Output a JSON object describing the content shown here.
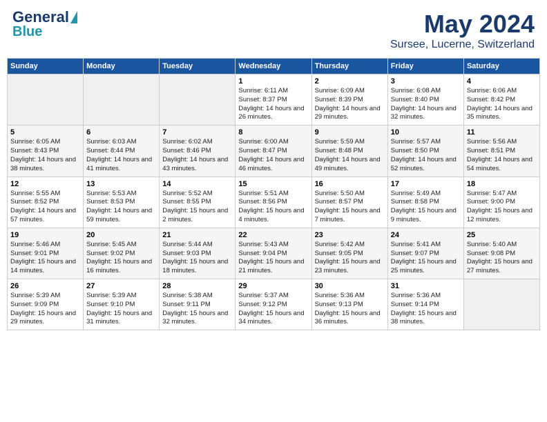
{
  "header": {
    "logo_general": "General",
    "logo_blue": "Blue",
    "title": "May 2024",
    "subtitle": "Sursee, Lucerne, Switzerland"
  },
  "days_of_week": [
    "Sunday",
    "Monday",
    "Tuesday",
    "Wednesday",
    "Thursday",
    "Friday",
    "Saturday"
  ],
  "weeks": [
    [
      {
        "num": "",
        "info": "",
        "empty": true
      },
      {
        "num": "",
        "info": "",
        "empty": true
      },
      {
        "num": "",
        "info": "",
        "empty": true
      },
      {
        "num": "1",
        "info": "Sunrise: 6:11 AM\nSunset: 8:37 PM\nDaylight: 14 hours\nand 26 minutes."
      },
      {
        "num": "2",
        "info": "Sunrise: 6:09 AM\nSunset: 8:39 PM\nDaylight: 14 hours\nand 29 minutes."
      },
      {
        "num": "3",
        "info": "Sunrise: 6:08 AM\nSunset: 8:40 PM\nDaylight: 14 hours\nand 32 minutes."
      },
      {
        "num": "4",
        "info": "Sunrise: 6:06 AM\nSunset: 8:42 PM\nDaylight: 14 hours\nand 35 minutes."
      }
    ],
    [
      {
        "num": "5",
        "info": "Sunrise: 6:05 AM\nSunset: 8:43 PM\nDaylight: 14 hours\nand 38 minutes."
      },
      {
        "num": "6",
        "info": "Sunrise: 6:03 AM\nSunset: 8:44 PM\nDaylight: 14 hours\nand 41 minutes."
      },
      {
        "num": "7",
        "info": "Sunrise: 6:02 AM\nSunset: 8:46 PM\nDaylight: 14 hours\nand 43 minutes."
      },
      {
        "num": "8",
        "info": "Sunrise: 6:00 AM\nSunset: 8:47 PM\nDaylight: 14 hours\nand 46 minutes."
      },
      {
        "num": "9",
        "info": "Sunrise: 5:59 AM\nSunset: 8:48 PM\nDaylight: 14 hours\nand 49 minutes."
      },
      {
        "num": "10",
        "info": "Sunrise: 5:57 AM\nSunset: 8:50 PM\nDaylight: 14 hours\nand 52 minutes."
      },
      {
        "num": "11",
        "info": "Sunrise: 5:56 AM\nSunset: 8:51 PM\nDaylight: 14 hours\nand 54 minutes."
      }
    ],
    [
      {
        "num": "12",
        "info": "Sunrise: 5:55 AM\nSunset: 8:52 PM\nDaylight: 14 hours\nand 57 minutes."
      },
      {
        "num": "13",
        "info": "Sunrise: 5:53 AM\nSunset: 8:53 PM\nDaylight: 14 hours\nand 59 minutes."
      },
      {
        "num": "14",
        "info": "Sunrise: 5:52 AM\nSunset: 8:55 PM\nDaylight: 15 hours\nand 2 minutes."
      },
      {
        "num": "15",
        "info": "Sunrise: 5:51 AM\nSunset: 8:56 PM\nDaylight: 15 hours\nand 4 minutes."
      },
      {
        "num": "16",
        "info": "Sunrise: 5:50 AM\nSunset: 8:57 PM\nDaylight: 15 hours\nand 7 minutes."
      },
      {
        "num": "17",
        "info": "Sunrise: 5:49 AM\nSunset: 8:58 PM\nDaylight: 15 hours\nand 9 minutes."
      },
      {
        "num": "18",
        "info": "Sunrise: 5:47 AM\nSunset: 9:00 PM\nDaylight: 15 hours\nand 12 minutes."
      }
    ],
    [
      {
        "num": "19",
        "info": "Sunrise: 5:46 AM\nSunset: 9:01 PM\nDaylight: 15 hours\nand 14 minutes."
      },
      {
        "num": "20",
        "info": "Sunrise: 5:45 AM\nSunset: 9:02 PM\nDaylight: 15 hours\nand 16 minutes."
      },
      {
        "num": "21",
        "info": "Sunrise: 5:44 AM\nSunset: 9:03 PM\nDaylight: 15 hours\nand 18 minutes."
      },
      {
        "num": "22",
        "info": "Sunrise: 5:43 AM\nSunset: 9:04 PM\nDaylight: 15 hours\nand 21 minutes."
      },
      {
        "num": "23",
        "info": "Sunrise: 5:42 AM\nSunset: 9:05 PM\nDaylight: 15 hours\nand 23 minutes."
      },
      {
        "num": "24",
        "info": "Sunrise: 5:41 AM\nSunset: 9:07 PM\nDaylight: 15 hours\nand 25 minutes."
      },
      {
        "num": "25",
        "info": "Sunrise: 5:40 AM\nSunset: 9:08 PM\nDaylight: 15 hours\nand 27 minutes."
      }
    ],
    [
      {
        "num": "26",
        "info": "Sunrise: 5:39 AM\nSunset: 9:09 PM\nDaylight: 15 hours\nand 29 minutes."
      },
      {
        "num": "27",
        "info": "Sunrise: 5:39 AM\nSunset: 9:10 PM\nDaylight: 15 hours\nand 31 minutes."
      },
      {
        "num": "28",
        "info": "Sunrise: 5:38 AM\nSunset: 9:11 PM\nDaylight: 15 hours\nand 32 minutes."
      },
      {
        "num": "29",
        "info": "Sunrise: 5:37 AM\nSunset: 9:12 PM\nDaylight: 15 hours\nand 34 minutes."
      },
      {
        "num": "30",
        "info": "Sunrise: 5:36 AM\nSunset: 9:13 PM\nDaylight: 15 hours\nand 36 minutes."
      },
      {
        "num": "31",
        "info": "Sunrise: 5:36 AM\nSunset: 9:14 PM\nDaylight: 15 hours\nand 38 minutes."
      },
      {
        "num": "",
        "info": "",
        "empty": true
      }
    ]
  ]
}
